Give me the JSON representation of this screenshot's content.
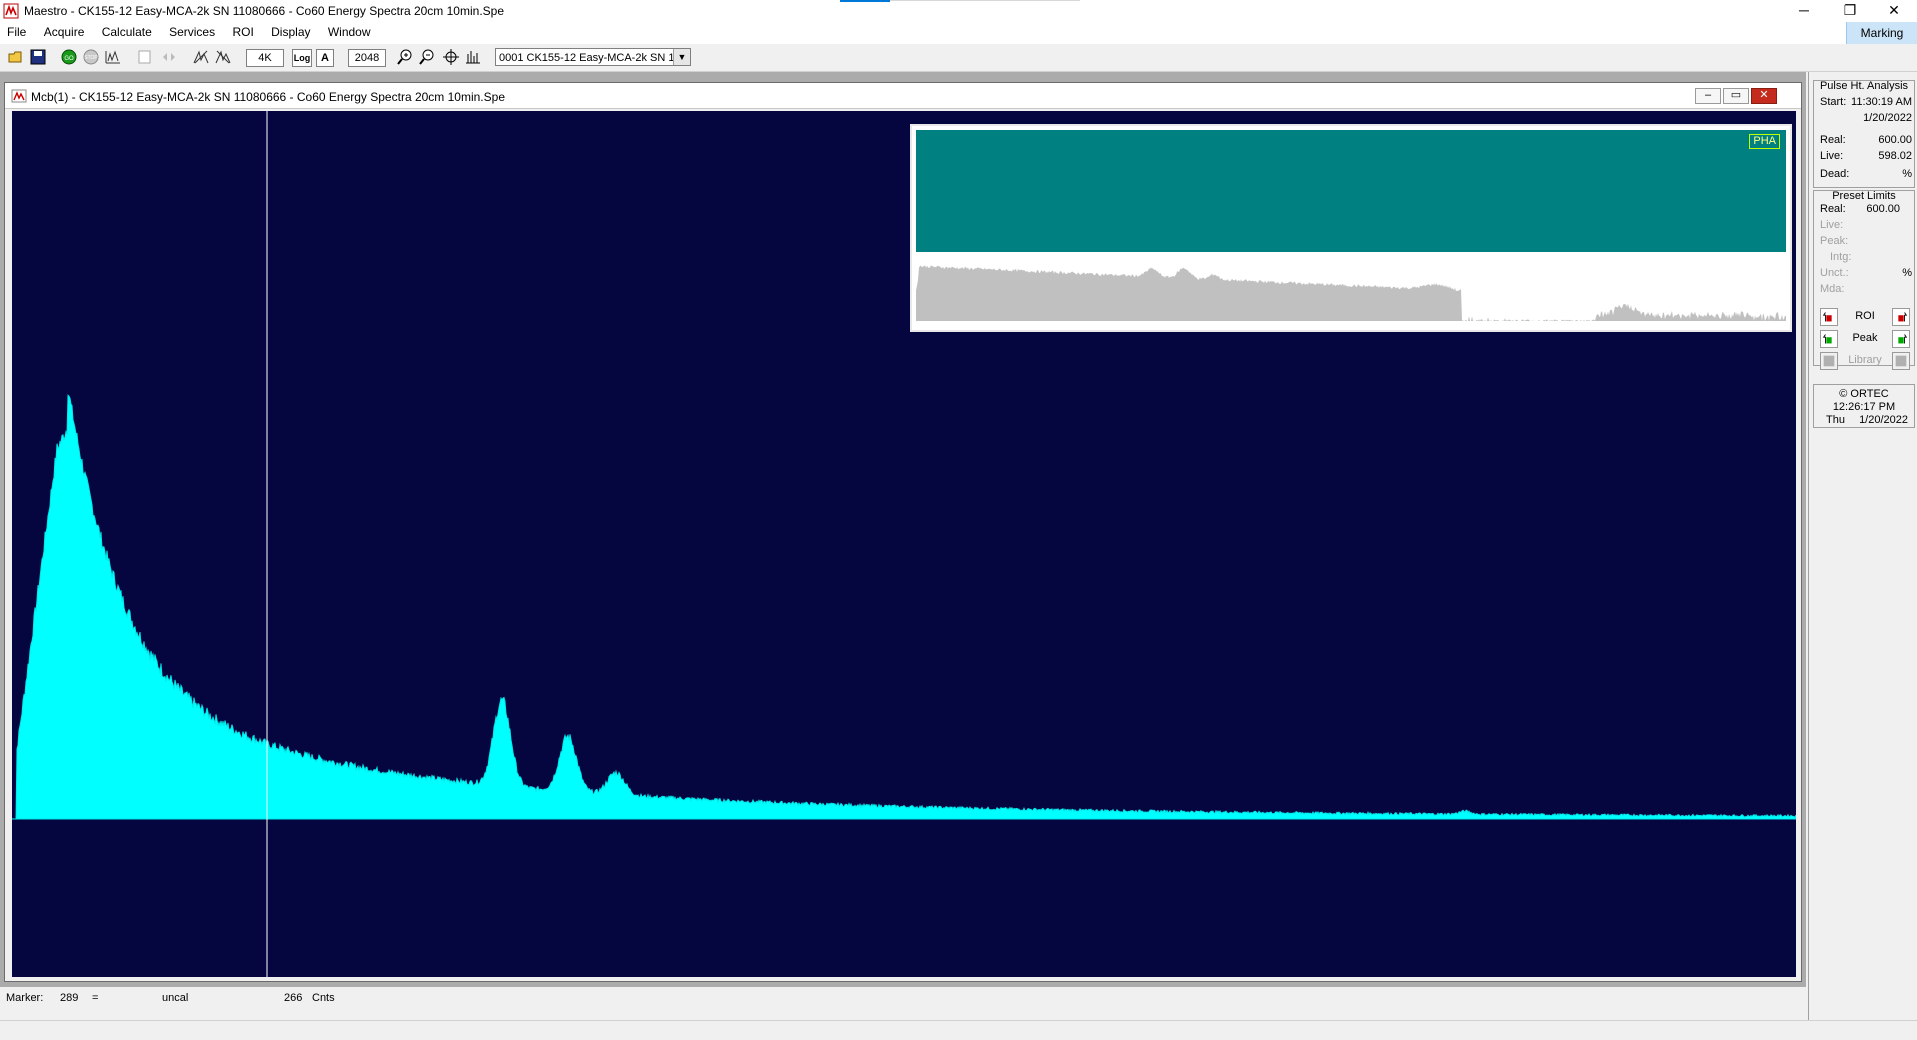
{
  "window": {
    "title": "Maestro - CK155-12 Easy-MCA-2k SN 11080666 - Co60 Energy Spectra 20cm 10min.Spe",
    "minimize_glyph": "─",
    "restore_glyph": "❐",
    "close_glyph": "✕"
  },
  "menu": {
    "items": [
      "File",
      "Acquire",
      "Calculate",
      "Services",
      "ROI",
      "Display",
      "Window"
    ],
    "marking": "Marking"
  },
  "toolbar": {
    "view_4k": "4K",
    "log": "Log",
    "auto": "A",
    "scale": "2048",
    "detector": "0001  CK155-12 Easy-MCA-2k SN 11"
  },
  "mdi": {
    "title": "Mcb(1) - CK155-12 Easy-MCA-2k SN 11080666 - Co60 Energy Spectra 20cm 10min.Spe"
  },
  "overview": {
    "badge": "PHA"
  },
  "status": {
    "marker_label": "Marker:",
    "marker_value": "289",
    "equals": "=",
    "energy": "uncal",
    "counts": "266",
    "counts_unit": "Cnts"
  },
  "side": {
    "pha_title": "Pulse Ht. Analysis",
    "start_label": "Start:",
    "start_time": "11:30:19 AM",
    "start_date": "1/20/2022",
    "real_label": "Real:",
    "real_value": "600.00",
    "live_label": "Live:",
    "live_value": "598.02",
    "dead_label": "Dead:",
    "dead_unit": "%",
    "preset_title": "Preset Limits",
    "preset_real_label": "Real:",
    "preset_real_value": "600.00",
    "preset_live_label": "Live:",
    "preset_peak_label": "Peak:",
    "preset_intg_label": "Intg:",
    "preset_unct_label": "Unct.:",
    "preset_unct_unit": "%",
    "preset_mda_label": "Mda:",
    "roi_label": "ROI",
    "peak_label": "Peak",
    "library_label": "Library",
    "brand": "© ORTEC",
    "clock_time": "12:26:17 PM",
    "clock_day": "Thu",
    "clock_date": "1/20/2022"
  },
  "colors": {
    "spectrum_bg": "#050540",
    "spectrum_fill": "#00ffff",
    "overview_bg": "#008080",
    "overview_fill": "#c0c0c0",
    "marker_line": "#ffffff"
  },
  "spectrum": {
    "channels": 2048,
    "marker_channel": 289,
    "peaks_visible": [
      "~65",
      "~560",
      "~635",
      "~690"
    ]
  }
}
